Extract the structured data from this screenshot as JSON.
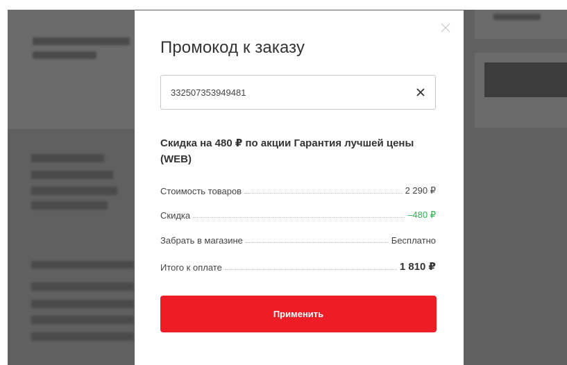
{
  "modal": {
    "title": "Промокод к заказу",
    "promo_code_value": "332507353949481",
    "discount_headline": "Скидка на 480 ₽ по акции Гарантия лучшей цены (WEB)",
    "summary": {
      "goods_cost": {
        "label": "Стоимость товаров",
        "value": "2 290 ₽"
      },
      "discount": {
        "label": "Скидка",
        "value": "–480 ₽"
      },
      "pickup": {
        "label": "Забрать в магазине",
        "value": "Бесплатно"
      },
      "total": {
        "label": "Итого к оплате",
        "value": "1 810 ₽"
      }
    },
    "apply_button_label": "Применить"
  },
  "icons": {
    "modal_close": "close-icon",
    "clear_input": "clear-icon"
  },
  "colors": {
    "accent": "#ee1c25",
    "discount_green": "#2bb34f",
    "overlay": "#606060"
  }
}
